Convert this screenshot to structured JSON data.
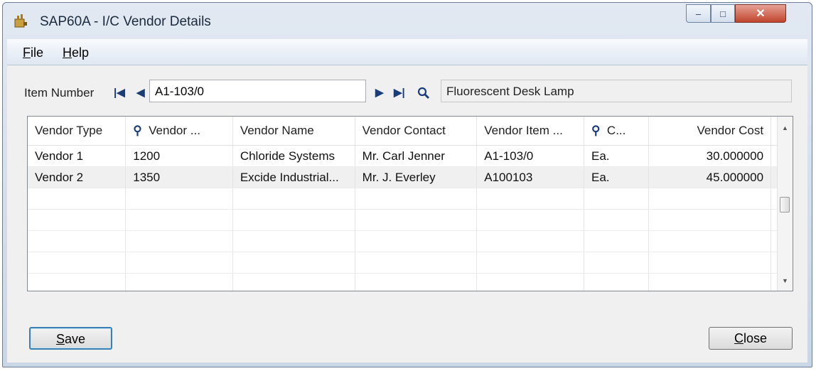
{
  "window": {
    "title": "SAP60A - I/C Vendor Details",
    "controls": {
      "minimize": "–",
      "maximize": "□",
      "close": "✕"
    }
  },
  "menu": [
    {
      "label": "File"
    },
    {
      "label": "Help"
    }
  ],
  "item": {
    "label": "Item Number",
    "value": "A1-103/0",
    "description": "Fluorescent Desk Lamp"
  },
  "grid": {
    "columns": [
      "Vendor Type",
      "Vendor ...",
      "Vendor Name",
      "Vendor Contact",
      "Vendor Item ...",
      "C...",
      "Vendor Cost"
    ],
    "rows": [
      [
        "Vendor 1",
        "1200",
        "Chloride Systems",
        "Mr. Carl Jenner",
        "A1-103/0",
        "Ea.",
        "30.000000"
      ],
      [
        "Vendor 2",
        "1350",
        "Excide Industrial...",
        "Mr. J. Everley",
        "A100103",
        "Ea.",
        "45.000000"
      ]
    ]
  },
  "buttons": {
    "save": "Save",
    "close": "Close"
  },
  "colors": {
    "accent": "#3c7fb1",
    "close_button": "#c0442c",
    "row_alt": "#f0f0f0"
  }
}
